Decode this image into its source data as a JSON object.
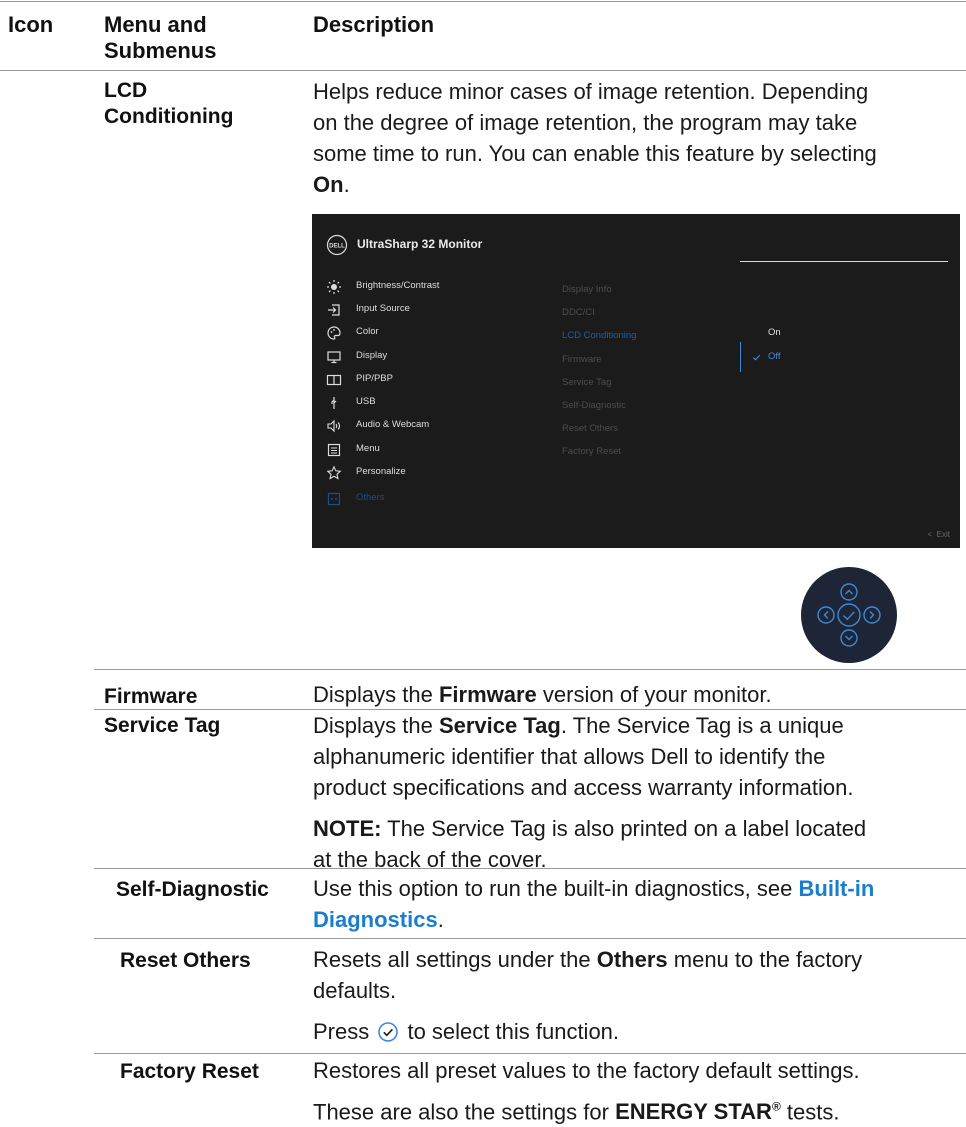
{
  "header": {
    "col_icon": "Icon",
    "col_menu_line1": "Menu and",
    "col_menu_line2": "Submenus",
    "col_desc": "Description"
  },
  "lcd": {
    "term_line1": "LCD",
    "term_line2": "Conditioning",
    "desc_line1": "Helps reduce minor cases of image retention. Depending",
    "desc_line2": "on the degree of image retention, the program may take",
    "desc_line3": "some time to run. You can enable this feature by selecting",
    "desc_on": "On",
    "desc_period": "."
  },
  "osd": {
    "title": "UltraSharp 32 Monitor",
    "logo_text": "DELL",
    "menu": [
      {
        "label": "Brightness/Contrast",
        "icon": "sun-icon"
      },
      {
        "label": "Input Source",
        "icon": "input-source-icon"
      },
      {
        "label": "Color",
        "icon": "palette-icon"
      },
      {
        "label": "Display",
        "icon": "monitor-icon"
      },
      {
        "label": "PIP/PBP",
        "icon": "pip-icon"
      },
      {
        "label": "USB",
        "icon": "usb-icon"
      },
      {
        "label": "Audio & Webcam",
        "icon": "speaker-icon"
      },
      {
        "label": "Menu",
        "icon": "menu-icon"
      },
      {
        "label": "Personalize",
        "icon": "star-icon"
      },
      {
        "label": "Others",
        "icon": "others-icon"
      }
    ],
    "submenu": [
      "Display Info",
      "DDC/CI",
      "LCD Conditioning",
      "Firmware",
      "Service Tag",
      "Self-Diagnostic",
      "Reset Others",
      "Factory Reset"
    ],
    "options": {
      "on": "On",
      "off": "Off"
    },
    "exit": "Exit",
    "active_color": "#1d5ea6",
    "bg_color": "#1b1b1b"
  },
  "firmware": {
    "term": "Firmware",
    "desc_pre": "Displays the ",
    "desc_bold": "Firmware",
    "desc_post": " version of your monitor."
  },
  "service_tag": {
    "term": "Service Tag",
    "desc_pre": "Displays the ",
    "desc_bold": "Service Tag",
    "desc_post": ". The Service Tag is a unique",
    "desc_line2": "alphanumeric identifier that allows Dell to identify the",
    "desc_line3": "product specifications and access warranty information.",
    "note_bold": "NOTE:",
    "note_line1": " The Service Tag is also printed on a label located",
    "note_line2": "at the back of the cover."
  },
  "self_diag": {
    "term": "Self-Diagnostic",
    "desc_pre": "Use this option to run the built-in diagnostics, see ",
    "link_line1": "Built-in",
    "link_line2": "Diagnostics",
    "desc_post": "."
  },
  "reset_others": {
    "term": "Reset Others",
    "desc_pre": "Resets all settings under the ",
    "desc_bold": "Others",
    "desc_post": " menu to the factory",
    "desc_line2": "defaults.",
    "press_pre": "Press ",
    "press_post": " to select this function."
  },
  "factory_reset": {
    "term": "Factory Reset",
    "desc_line1": "Restores all preset values to the factory default settings.",
    "desc_line2_pre": "These are also the settings for ",
    "desc_line2_bold": "ENERGY STAR",
    "desc_line2_sup": "®",
    "desc_line2_post": " tests."
  }
}
